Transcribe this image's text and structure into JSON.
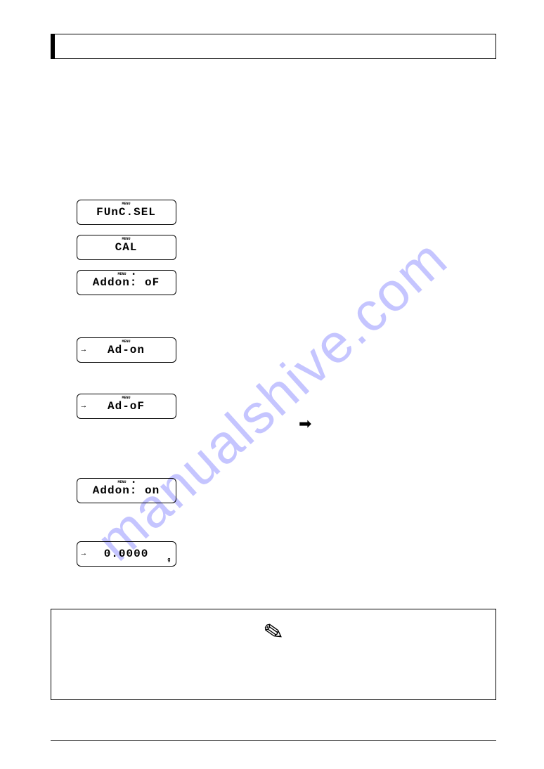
{
  "watermark": "manualshive.com",
  "lcd": {
    "d1": "FUnC.SEL",
    "d2": "CAL",
    "d3": "Addon: oF",
    "d4": "Ad-on",
    "d5": "Ad-oF",
    "d6": "Addon: on",
    "d7": "0.0000",
    "unit": "g"
  }
}
